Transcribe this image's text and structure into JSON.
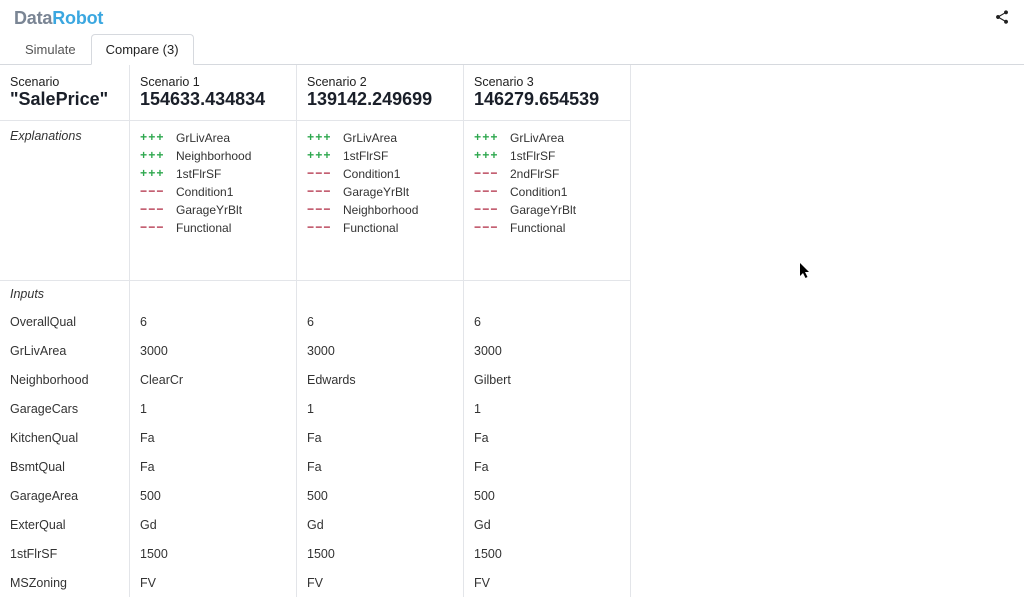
{
  "brand": {
    "part1": "Data",
    "part2": "Robot"
  },
  "tabs": {
    "simulate": "Simulate",
    "compare": "Compare (3)"
  },
  "labels": {
    "scenario": "Scenario",
    "target": "\"SalePrice\"",
    "explanations": "Explanations",
    "inputs": "Inputs"
  },
  "scenarios": [
    {
      "title": "Scenario 1",
      "value": "154633.434834",
      "explanations": [
        {
          "sign": "pos",
          "mag": 3,
          "feat": "GrLivArea"
        },
        {
          "sign": "pos",
          "mag": 3,
          "feat": "Neighborhood"
        },
        {
          "sign": "pos",
          "mag": 3,
          "feat": "1stFlrSF"
        },
        {
          "sign": "neg",
          "mag": 3,
          "feat": "Condition1"
        },
        {
          "sign": "neg",
          "mag": 3,
          "feat": "GarageYrBlt"
        },
        {
          "sign": "neg",
          "mag": 3,
          "feat": "Functional"
        }
      ]
    },
    {
      "title": "Scenario 2",
      "value": "139142.249699",
      "explanations": [
        {
          "sign": "pos",
          "mag": 3,
          "feat": "GrLivArea"
        },
        {
          "sign": "pos",
          "mag": 3,
          "feat": "1stFlrSF"
        },
        {
          "sign": "neg",
          "mag": 3,
          "feat": "Condition1"
        },
        {
          "sign": "neg",
          "mag": 3,
          "feat": "GarageYrBlt"
        },
        {
          "sign": "neg",
          "mag": 3,
          "feat": "Neighborhood"
        },
        {
          "sign": "neg",
          "mag": 3,
          "feat": "Functional"
        }
      ]
    },
    {
      "title": "Scenario 3",
      "value": "146279.654539",
      "explanations": [
        {
          "sign": "pos",
          "mag": 3,
          "feat": "GrLivArea"
        },
        {
          "sign": "pos",
          "mag": 3,
          "feat": "1stFlrSF"
        },
        {
          "sign": "neg",
          "mag": 3,
          "feat": "2ndFlrSF"
        },
        {
          "sign": "neg",
          "mag": 3,
          "feat": "Condition1"
        },
        {
          "sign": "neg",
          "mag": 3,
          "feat": "GarageYrBlt"
        },
        {
          "sign": "neg",
          "mag": 3,
          "feat": "Functional"
        }
      ]
    }
  ],
  "input_rows": [
    {
      "name": "OverallQual",
      "vals": [
        "6",
        "6",
        "6"
      ]
    },
    {
      "name": "GrLivArea",
      "vals": [
        "3000",
        "3000",
        "3000"
      ]
    },
    {
      "name": "Neighborhood",
      "vals": [
        "ClearCr",
        "Edwards",
        "Gilbert"
      ]
    },
    {
      "name": "GarageCars",
      "vals": [
        "1",
        "1",
        "1"
      ]
    },
    {
      "name": "KitchenQual",
      "vals": [
        "Fa",
        "Fa",
        "Fa"
      ]
    },
    {
      "name": "BsmtQual",
      "vals": [
        "Fa",
        "Fa",
        "Fa"
      ]
    },
    {
      "name": "GarageArea",
      "vals": [
        "500",
        "500",
        "500"
      ]
    },
    {
      "name": "ExterQual",
      "vals": [
        "Gd",
        "Gd",
        "Gd"
      ]
    },
    {
      "name": "1stFlrSF",
      "vals": [
        "1500",
        "1500",
        "1500"
      ]
    },
    {
      "name": "MSZoning",
      "vals": [
        "FV",
        "FV",
        "FV"
      ]
    }
  ]
}
